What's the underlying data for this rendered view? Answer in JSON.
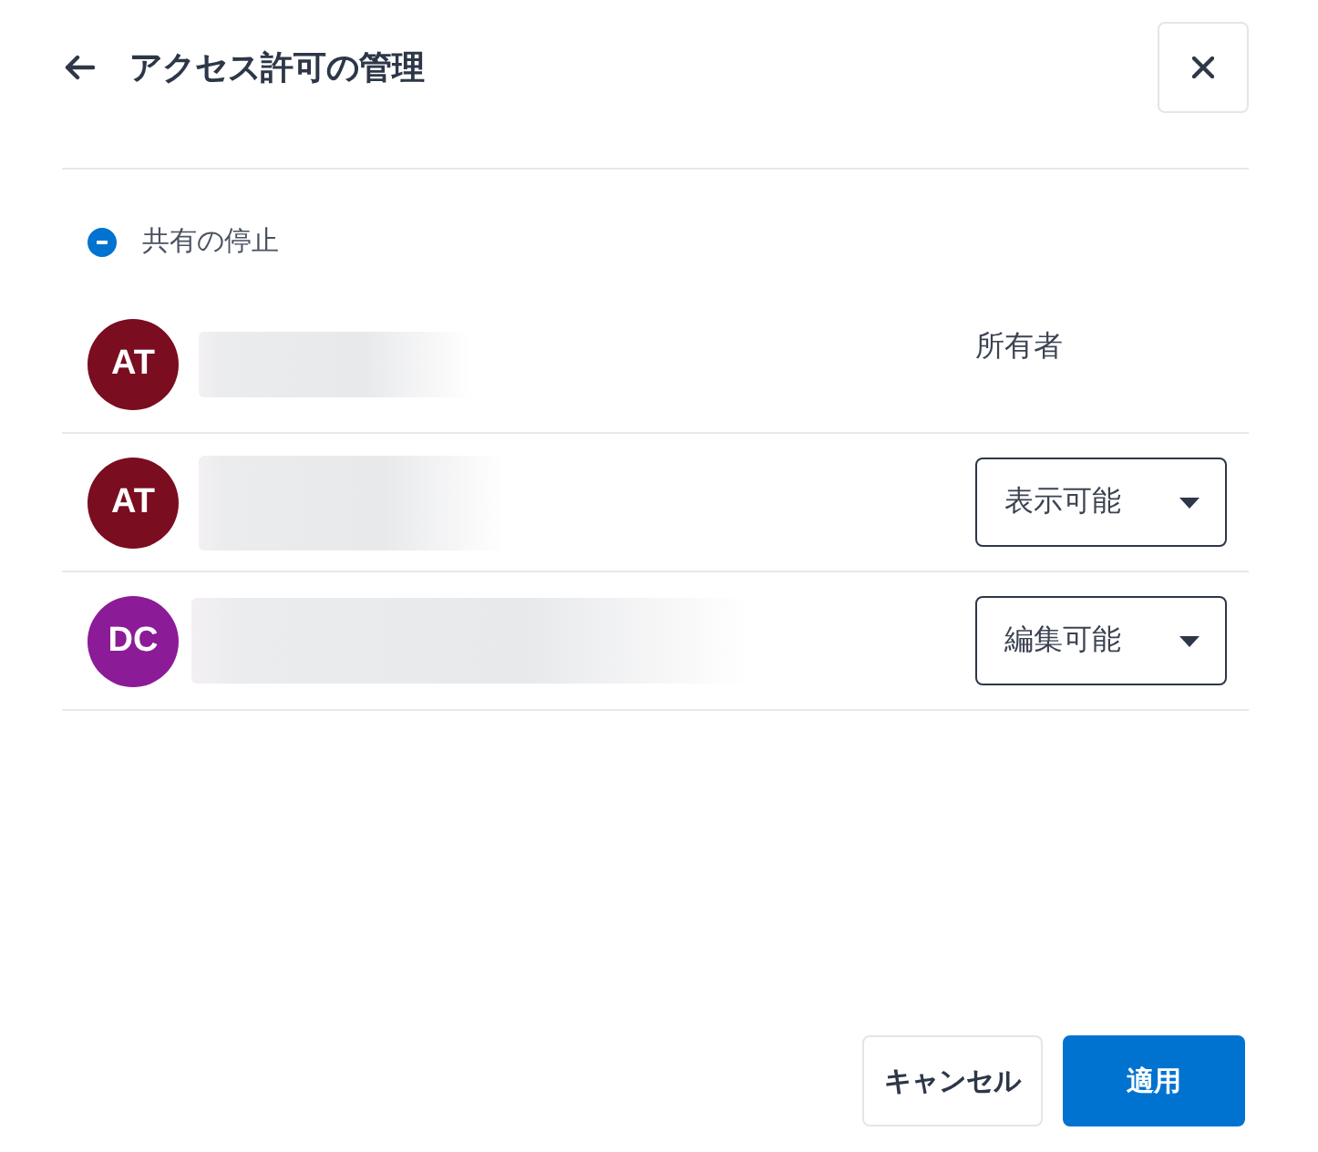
{
  "header": {
    "title": "アクセス許可の管理"
  },
  "stop_sharing": {
    "label": "共有の停止"
  },
  "members": [
    {
      "initials": "AT",
      "color": "#7a0d1f",
      "kind": "owner",
      "role": "所有者"
    },
    {
      "initials": "AT",
      "color": "#7a0d1f",
      "kind": "dropdown",
      "role": "表示可能"
    },
    {
      "initials": "DC",
      "color": "#8c1b98",
      "kind": "dropdown",
      "role": "編集可能"
    }
  ],
  "buttons": [
    {
      "label": "キャンセル",
      "kind": "secondary"
    },
    {
      "label": "適用",
      "kind": "primary"
    }
  ]
}
